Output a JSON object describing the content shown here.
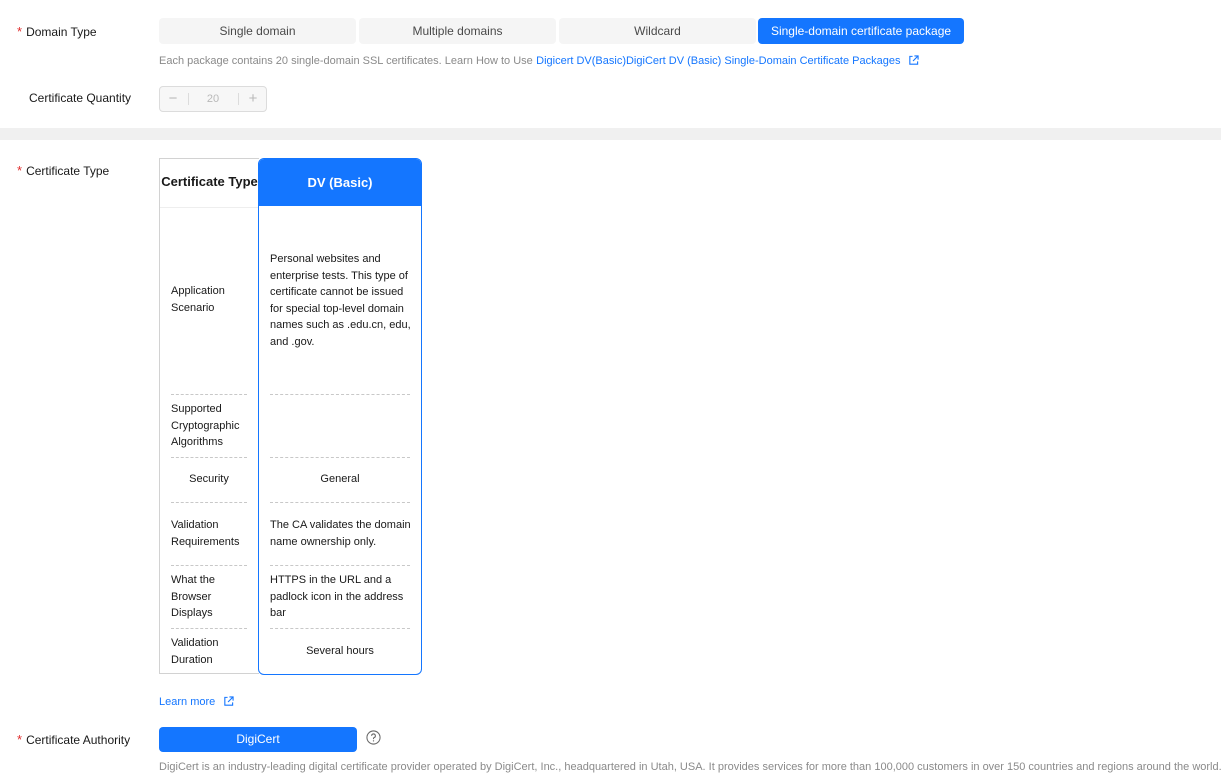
{
  "domain_type": {
    "label": "Domain Type",
    "required_mark": "*",
    "options": [
      {
        "label": "Single domain",
        "selected": false
      },
      {
        "label": "Multiple domains",
        "selected": false
      },
      {
        "label": "Wildcard",
        "selected": false
      },
      {
        "label": "Single-domain certificate package",
        "selected": true
      }
    ],
    "hint_text": "Each package contains 20 single-domain SSL certificates. Learn How to Use",
    "hint_link": "Digicert DV(Basic)DigiCert DV (Basic) Single-Domain Certificate Packages",
    "hint_link_icon": "external-link-icon"
  },
  "certificate_quantity": {
    "label": "Certificate Quantity",
    "value": "20",
    "minus": "−",
    "plus": "+"
  },
  "certificate_type": {
    "label": "Certificate Type",
    "required_mark": "*",
    "header_col_title": "Certificate Type",
    "selected_col_title": "DV (Basic)",
    "rows": [
      {
        "name": "Application Scenario",
        "value": "Personal websites and enterprise tests. This type of certificate cannot be issued for special top-level domain names such as .edu.cn, edu, and .gov."
      },
      {
        "name": "Supported Cryptographic Algorithms",
        "value": ""
      },
      {
        "name": "Security",
        "value": "General"
      },
      {
        "name": "Validation Requirements",
        "value": "The CA validates the domain name ownership only."
      },
      {
        "name": "What the Browser Displays",
        "value": "HTTPS in the URL and a padlock icon in the address bar"
      },
      {
        "name": "Validation Duration",
        "value": "Several hours"
      }
    ],
    "learn_more": "Learn more"
  },
  "certificate_authority": {
    "label": "Certificate Authority",
    "required_mark": "*",
    "selected": "DigiCert",
    "help_icon": "question-circle-icon",
    "description": "DigiCert is an industry-leading digital certificate provider operated by DigiCert, Inc., headquartered in Utah, USA. It provides services for more than 100,000 customers in over 150 countries and regions around the world."
  },
  "colors": {
    "accent": "#1476ff",
    "required": "#e02c2c",
    "segment_bg": "#f5f5f5",
    "hint": "#8a8a8a"
  }
}
